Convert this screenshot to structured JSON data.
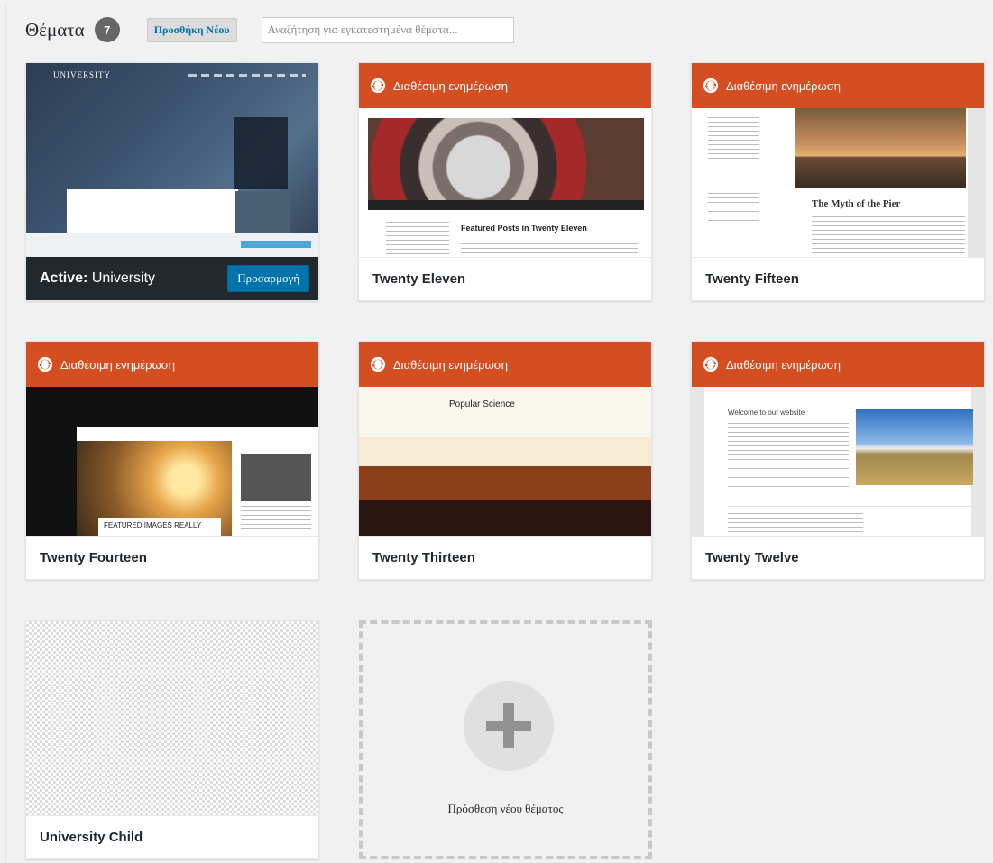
{
  "header": {
    "title": "Θέματα",
    "count": "7",
    "add_new_label": "Προσθήκη Νέου",
    "search_placeholder": "Αναζήτηση για εγκατεστημένα θέματα..."
  },
  "update_label": "Διαθέσιμη ενημέρωση",
  "themes": [
    {
      "name": "University",
      "active_prefix": "Active:",
      "customize_label": "Προσαρμογή",
      "logo_text": "UNIVERSITY"
    },
    {
      "name": "Twenty Eleven",
      "shot_title": "Featured Posts in Twenty Eleven"
    },
    {
      "name": "Twenty Fifteen",
      "shot_title": "The Myth of the Pier"
    },
    {
      "name": "Twenty Fourteen",
      "shot_title": "FEATURED IMAGES REALLY"
    },
    {
      "name": "Twenty Thirteen",
      "shot_title": "Popular Science"
    },
    {
      "name": "Twenty Twelve",
      "shot_title": "Welcome to our website"
    },
    {
      "name": "University Child"
    }
  ],
  "add_theme_label": "Πρόσθεση νέου θέματος",
  "colors": {
    "update_bar": "#d54e21",
    "active_bar": "#23282d",
    "primary_button": "#0073aa"
  }
}
